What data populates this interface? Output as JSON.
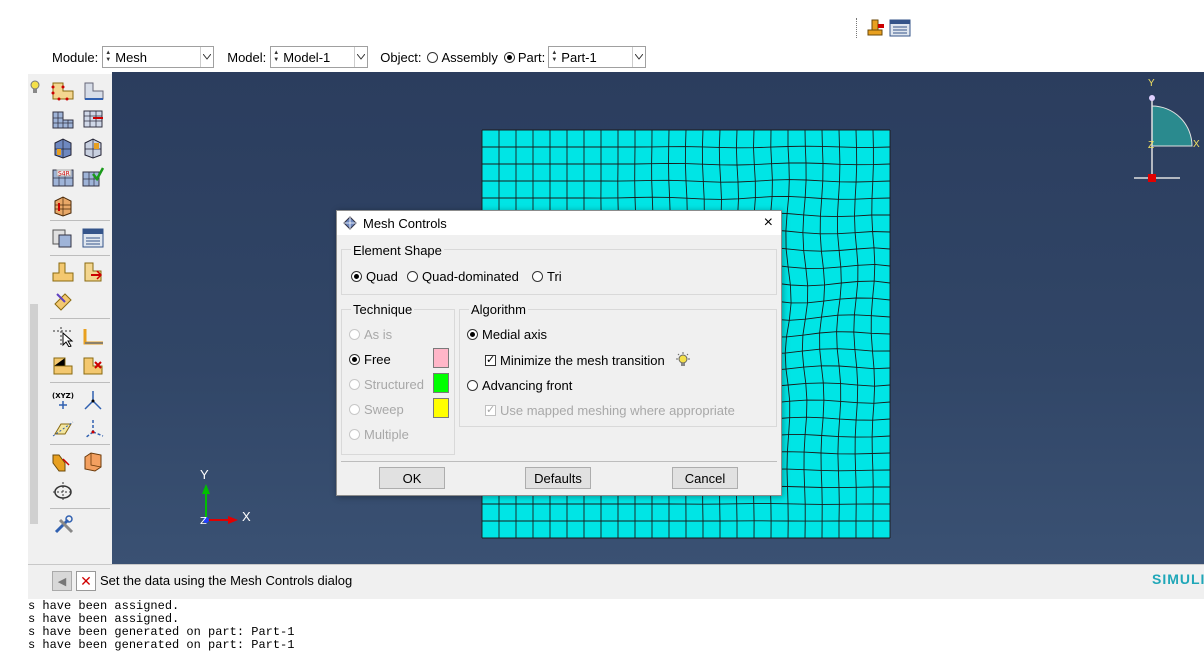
{
  "toolbar": {
    "module_label": "Module:",
    "module_value": "Mesh",
    "model_label": "Model:",
    "model_value": "Model-1",
    "object_label": "Object:",
    "assembly_label": "Assembly",
    "part_label": "Part:",
    "part_value": "Part-1",
    "object_selected": "Part"
  },
  "viewport": {
    "mesh_color": "#00e5e5",
    "mesh_line_color": "#1a1a1a",
    "triad_small": {
      "y_label": "Y",
      "x_label": "X"
    },
    "triad_corner": {
      "y_label": "Y",
      "x_label": "X",
      "z_label": "Z"
    }
  },
  "dialog": {
    "title": "Mesh Controls",
    "close_label": "×",
    "element_shape": {
      "label": "Element Shape",
      "options": [
        "Quad",
        "Quad-dominated",
        "Tri"
      ],
      "selected": "Quad"
    },
    "technique": {
      "label": "Technique",
      "options": [
        {
          "label": "As is",
          "enabled": false,
          "color": ""
        },
        {
          "label": "Free",
          "enabled": true,
          "selected": true,
          "color": "#ffb6c8"
        },
        {
          "label": "Structured",
          "enabled": false,
          "color": "#00ff00"
        },
        {
          "label": "Sweep",
          "enabled": false,
          "color": "#ffff00"
        },
        {
          "label": "Multiple",
          "enabled": false,
          "color": ""
        }
      ]
    },
    "algorithm": {
      "label": "Algorithm",
      "medial_axis": "Medial axis",
      "minimize_transition": "Minimize the mesh transition",
      "advancing_front": "Advancing front",
      "use_mapped": "Use mapped meshing where appropriate",
      "selected": "Medial axis",
      "minimize_checked": true,
      "use_mapped_checked": true
    },
    "buttons": {
      "ok": "OK",
      "defaults": "Defaults",
      "cancel": "Cancel"
    }
  },
  "prompt": {
    "message": "Set the data using the Mesh Controls dialog",
    "brand": "SIMULIA"
  },
  "messages": [
    "s have been assigned.",
    "s have been assigned.",
    "s have been generated on part: Part-1",
    "s have been generated on part: Part-1"
  ]
}
